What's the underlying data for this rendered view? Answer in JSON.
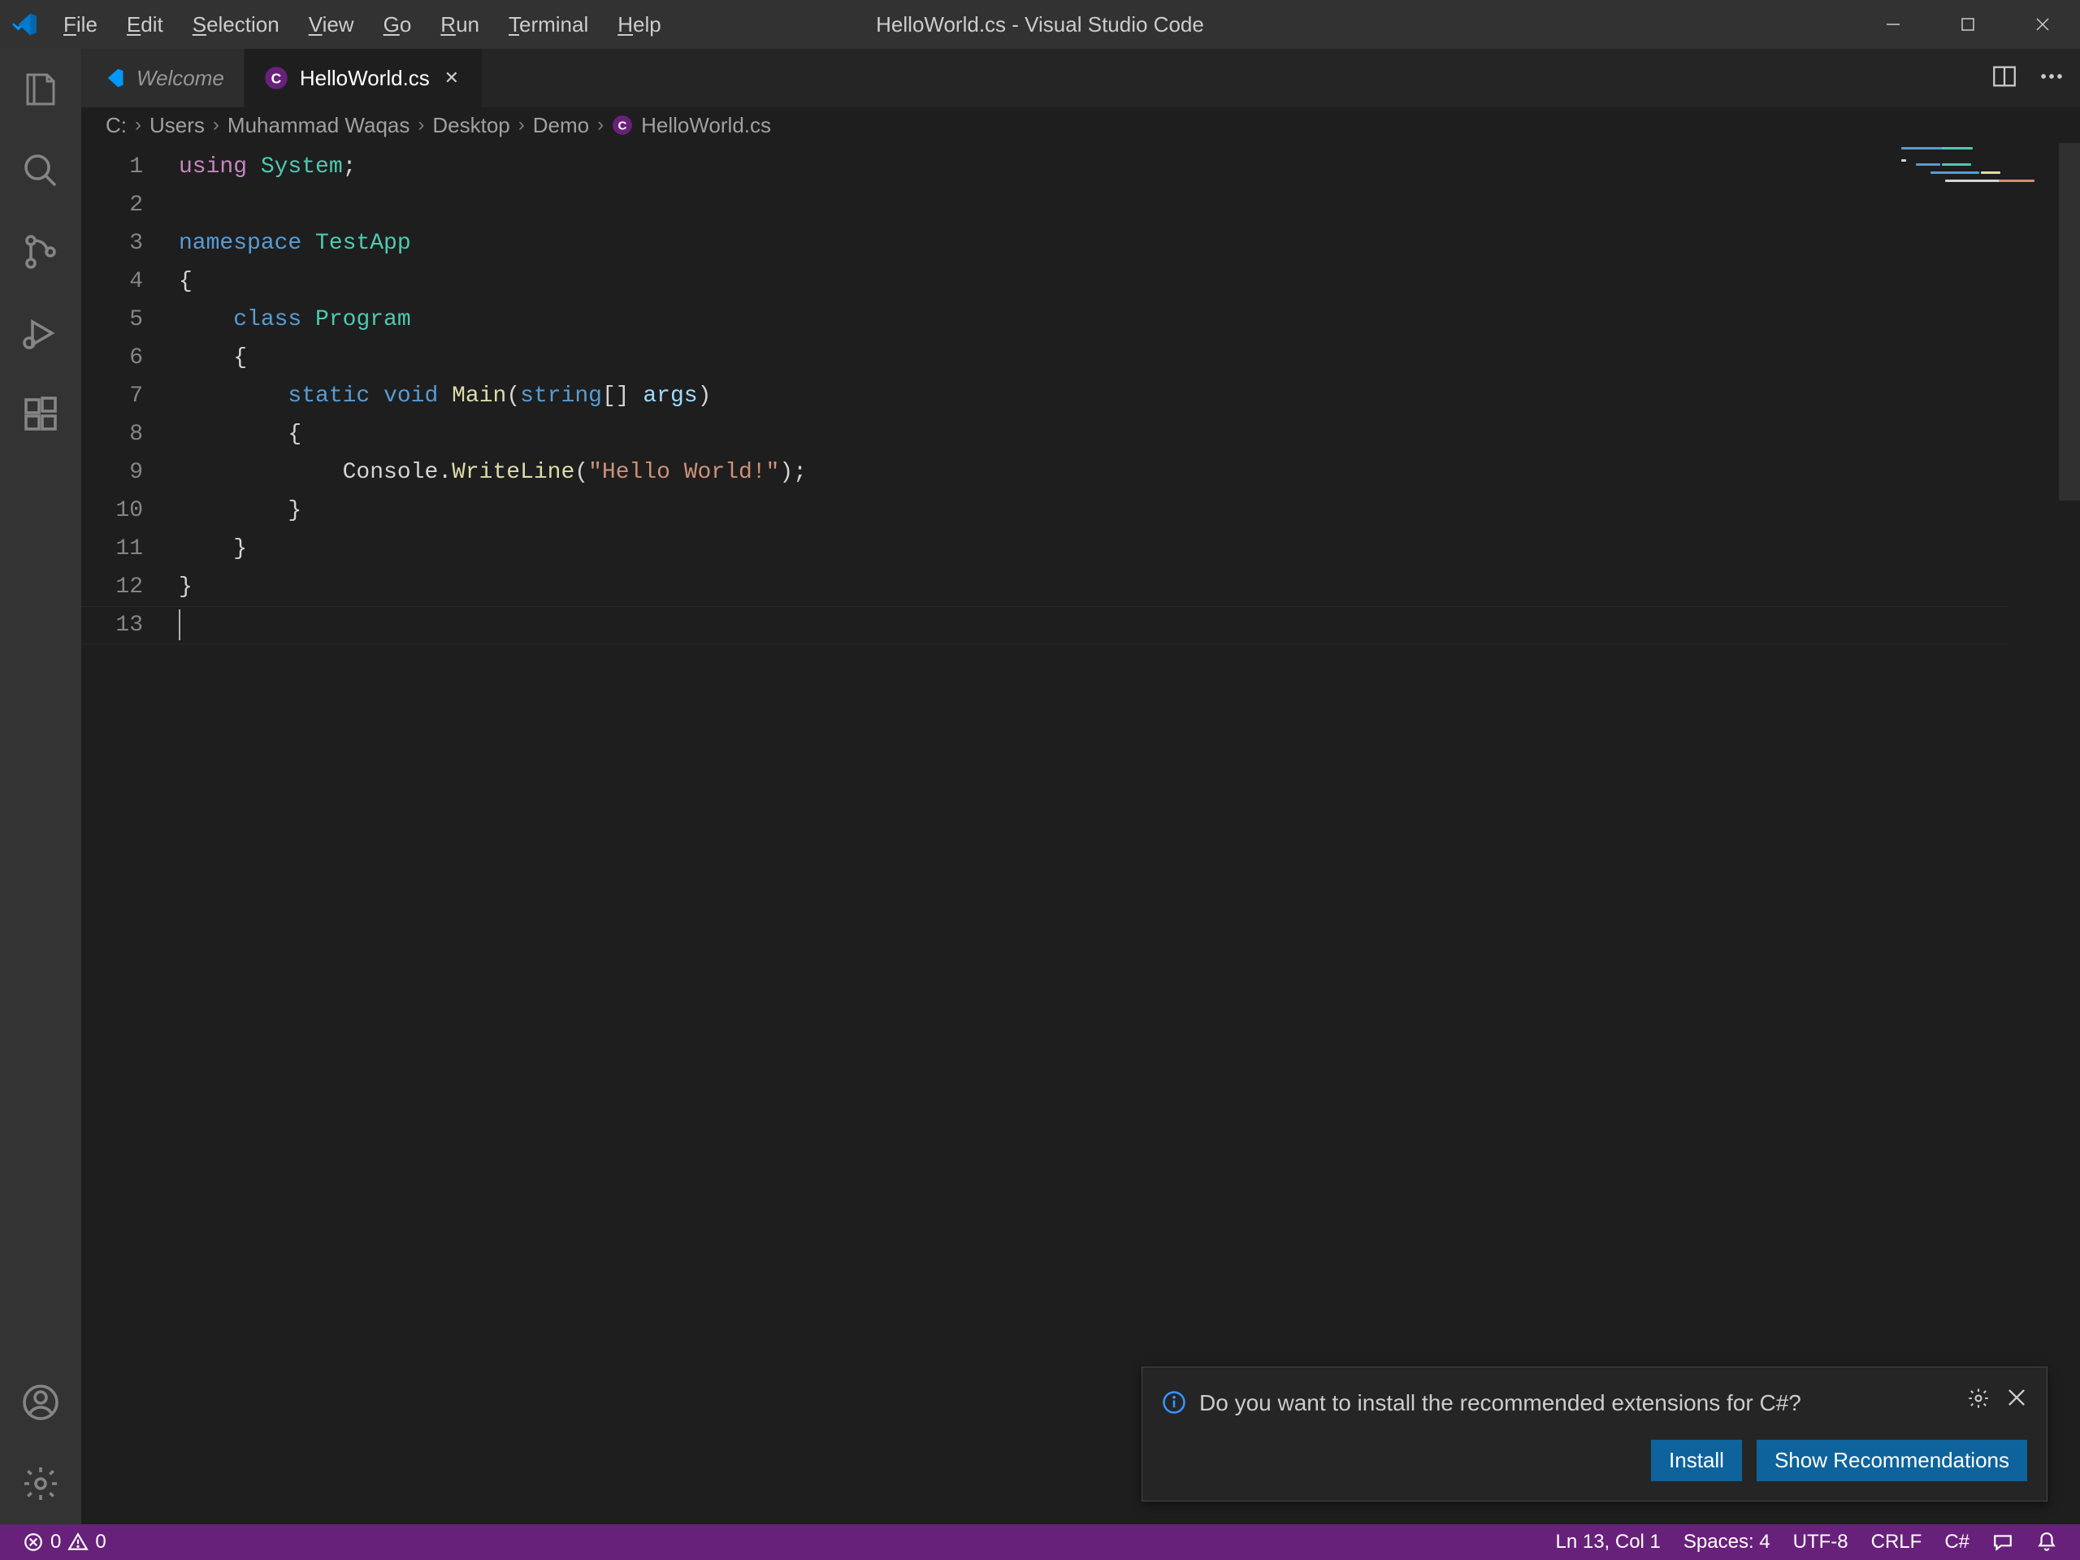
{
  "window": {
    "title": "HelloWorld.cs - Visual Studio Code"
  },
  "menu": {
    "file": "File",
    "edit": "Edit",
    "selection": "Selection",
    "view": "View",
    "go": "Go",
    "run": "Run",
    "terminal": "Terminal",
    "help": "Help"
  },
  "tabs": {
    "items": [
      {
        "label": "Welcome",
        "active": false
      },
      {
        "label": "HelloWorld.cs",
        "active": true
      }
    ]
  },
  "breadcrumbs": {
    "parts": [
      "C:",
      "Users",
      "Muhammad Waqas",
      "Desktop",
      "Demo",
      "HelloWorld.cs"
    ]
  },
  "code": {
    "line_count": 13,
    "lines": [
      [
        [
          "using",
          "pp"
        ],
        [
          " ",
          "pn"
        ],
        [
          "System",
          "using-ns"
        ],
        [
          ";",
          "pn"
        ]
      ],
      [],
      [
        [
          "namespace",
          "kw"
        ],
        [
          " ",
          "pn"
        ],
        [
          "TestApp",
          "ns"
        ]
      ],
      [
        [
          "{",
          "pn"
        ]
      ],
      [
        [
          "    ",
          "pn"
        ],
        [
          "class",
          "kw"
        ],
        [
          " ",
          "pn"
        ],
        [
          "Program",
          "cls"
        ]
      ],
      [
        [
          "    {",
          "pn"
        ]
      ],
      [
        [
          "        ",
          "pn"
        ],
        [
          "static",
          "kw"
        ],
        [
          " ",
          "pn"
        ],
        [
          "void",
          "kw"
        ],
        [
          " ",
          "pn"
        ],
        [
          "Main",
          "fn"
        ],
        [
          "(",
          "pn"
        ],
        [
          "string",
          "kw"
        ],
        [
          "[] ",
          "pn"
        ],
        [
          "args",
          "arg"
        ],
        [
          ")",
          "pn"
        ]
      ],
      [
        [
          "        {",
          "pn"
        ]
      ],
      [
        [
          "            Console.",
          "pn"
        ],
        [
          "WriteLine",
          "fn"
        ],
        [
          "(",
          "pn"
        ],
        [
          "\"Hello World!\"",
          "str"
        ],
        [
          ");",
          "pn"
        ]
      ],
      [
        [
          "        }",
          "pn"
        ]
      ],
      [
        [
          "    }",
          "pn"
        ]
      ],
      [
        [
          "}",
          "pn"
        ]
      ],
      []
    ]
  },
  "notification": {
    "message": "Do you want to install the recommended extensions for C#?",
    "install": "Install",
    "show": "Show Recommendations"
  },
  "status": {
    "errors": "0",
    "warnings": "0",
    "position": "Ln 13, Col 1",
    "spaces": "Spaces: 4",
    "encoding": "UTF-8",
    "eol": "CRLF",
    "lang": "C#"
  }
}
